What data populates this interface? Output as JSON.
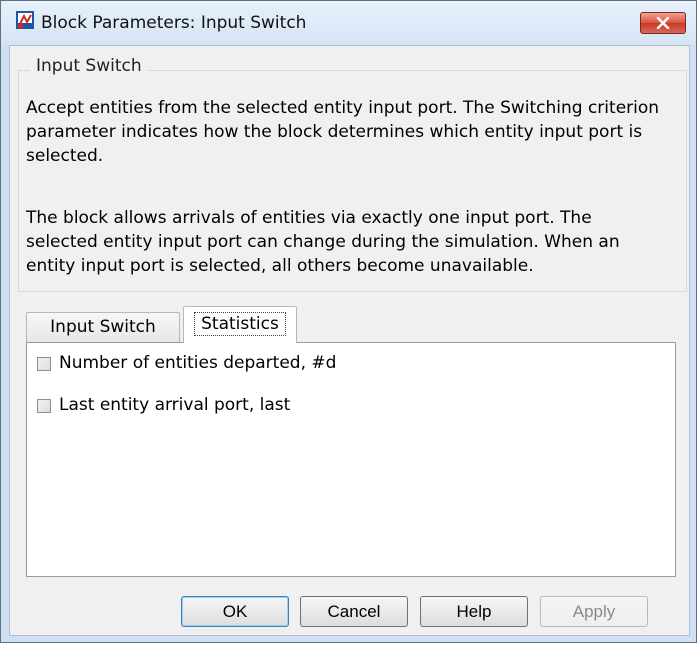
{
  "window": {
    "title": "Block Parameters: Input Switch",
    "icon": "block-parameters-icon",
    "close_icon": "close-icon"
  },
  "group": {
    "title": "Input Switch",
    "description_1": "Accept entities from the selected entity input port. The Switching criterion parameter indicates how the block determines which entity input port is selected.",
    "description_2": "The block allows arrivals of entities via exactly one input port. The selected entity input port can change during the simulation. When an entity input port is selected, all others become unavailable."
  },
  "tabs": [
    {
      "label": "Input Switch",
      "active": false
    },
    {
      "label": "Statistics",
      "active": true
    }
  ],
  "statistics": {
    "options": [
      {
        "label": "Number of entities departed, #d",
        "checked": false
      },
      {
        "label": "Last entity arrival port, last",
        "checked": false
      }
    ]
  },
  "buttons": {
    "ok": "OK",
    "cancel": "Cancel",
    "help": "Help",
    "apply": "Apply"
  },
  "colors": {
    "window_frame": "#cfe0f2",
    "close_button": "#d8543f",
    "dialog_background": "#f0f0f0"
  }
}
